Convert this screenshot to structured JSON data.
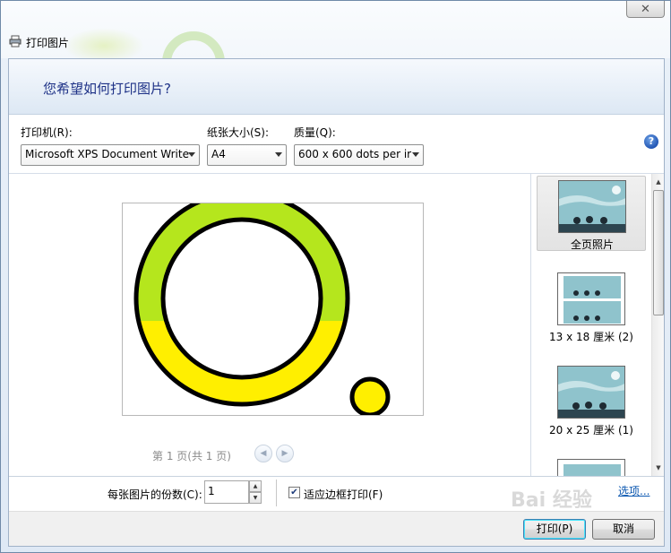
{
  "window": {
    "title": "打印图片",
    "close_glyph": "✕"
  },
  "header": {
    "heading": "您希望如何打印图片?"
  },
  "options": {
    "printer_label": "打印机(R):",
    "printer_value": "Microsoft XPS Document Write",
    "paper_label": "纸张大小(S):",
    "paper_value": "A4",
    "quality_label": "质量(Q):",
    "quality_value": "600 x 600 dots per ir",
    "help_glyph": "?"
  },
  "preview": {
    "page_info": "第 1 页(共 1 页)",
    "prev_glyph": "◀",
    "next_glyph": "▶",
    "colors": {
      "ring_green": "#b5e61d",
      "ring_yellow": "#ffef00",
      "outline": "#000000"
    }
  },
  "layouts": [
    {
      "label": "全页照片",
      "selected": true
    },
    {
      "label": "13 x 18 厘米 (2)",
      "selected": false
    },
    {
      "label": "20 x 25 厘米 (1)",
      "selected": false
    },
    {
      "label": "",
      "selected": false
    }
  ],
  "bottom": {
    "copies_label": "每张图片的份数(C):",
    "copies_value": "1",
    "fit_label": "适应边框打印(F)",
    "fit_checked": true,
    "options_link": "选项..."
  },
  "footer": {
    "print_label": "打印(P)",
    "cancel_label": "取消"
  },
  "watermark": {
    "text": "Bai 经验"
  }
}
